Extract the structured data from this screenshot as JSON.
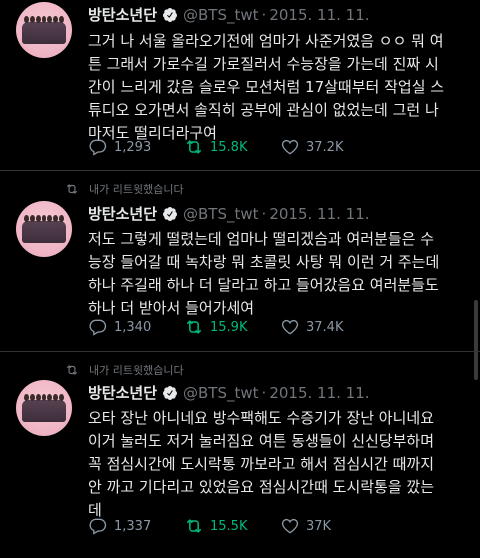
{
  "tweets": [
    {
      "retweeted_label": "",
      "name": "방탄소년단",
      "handle": "@BTS_twt",
      "date": "2015. 11. 11.",
      "text": "그거 나 서울 올라오기전에 엄마가 사준거였음 ㅇㅇ 뭐 여\n튼 그래서 가로수길 가로질러서 수능장을 가는데 진짜 시\n간이 느리게 갔음 슬로우 모션처럼 17살때부터 작업실 스\n튜디오 오가면서 솔직히 공부에 관심이 없었는데 그런 나\n마저도 떨리더라구여",
      "replies": "1,293",
      "retweets": "15.8K",
      "likes": "37.2K"
    },
    {
      "retweeted_label": "내가 리트윗했습니다",
      "name": "방탄소년단",
      "handle": "@BTS_twt",
      "date": "2015. 11. 11.",
      "text": "저도 그렇게 떨렸는데 엄마나 떨리겠슴과 여러분들은 수\n능장 들어갈 때 녹차랑 뭐 초콜릿 사탕 뭐 이런 거 주는데\n하나 주길래 하나 더 달라고 하고 들어갔음요 여러분들도\n하나 더 받아서 들어가세여",
      "replies": "1,340",
      "retweets": "15.9K",
      "likes": "37.4K"
    },
    {
      "retweeted_label": "내가 리트윗했습니다",
      "name": "방탄소년단",
      "handle": "@BTS_twt",
      "date": "2015. 11. 11.",
      "text": "오타 장난 아니네요 방수팩해도 수증기가 장난 아니네요\n이거 눌러도 저거 눌러짐요 여튼 동생들이 신신당부하며\n꼭 점심시간에 도시락통 까보라고 해서 점심시간 때까지\n안 까고 기다리고 있었음요 점심시간때 도시락통을 깠는\n데",
      "replies": "1,337",
      "retweets": "15.5K",
      "likes": "37K"
    }
  ],
  "icons": {
    "verified": "verified-badge-icon",
    "reply": "reply-icon",
    "retweet": "retweet-icon",
    "like": "heart-icon",
    "retweeted": "retweeted-icon"
  },
  "colors": {
    "background": "#000000",
    "text": "#e7e9ea",
    "muted": "#71767b",
    "retweet_green": "#00ba7c",
    "verified": "#e7e9ea"
  }
}
